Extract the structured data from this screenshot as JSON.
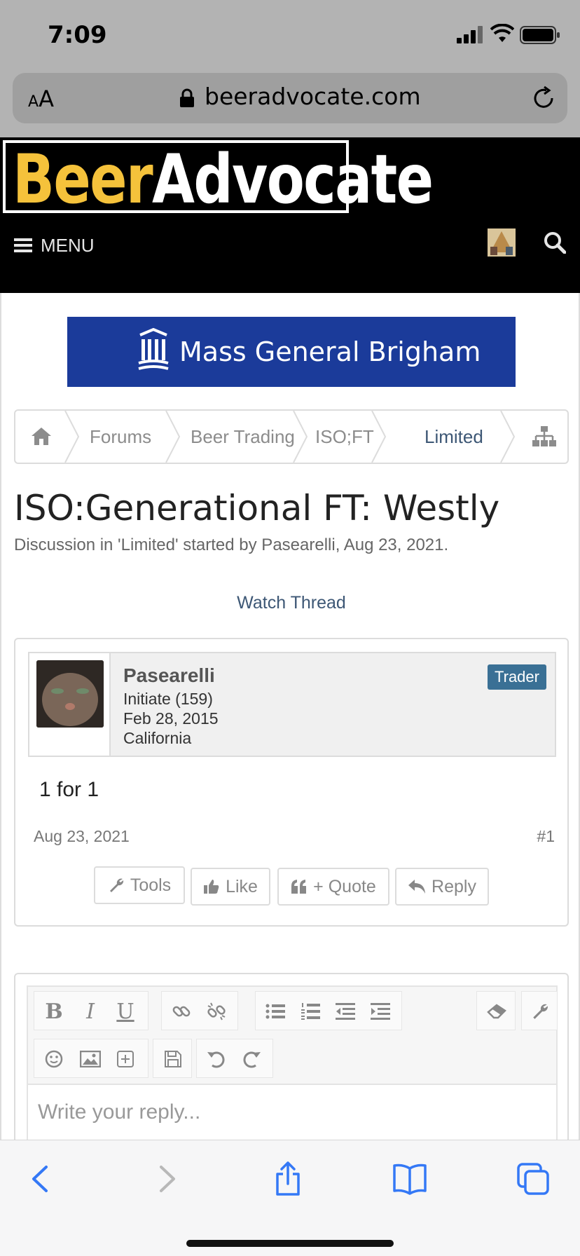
{
  "status": {
    "time": "7:09"
  },
  "browser": {
    "text_size": "AA",
    "url": "beeradvocate.com"
  },
  "site": {
    "logo_beer": "Beer",
    "logo_advocate": "Advocate",
    "menu_label": "MENU"
  },
  "ad": {
    "text": "Mass General Brigham"
  },
  "breadcrumbs": [
    "Forums",
    "Beer Trading",
    "ISO;FT",
    "Limited"
  ],
  "thread": {
    "title": "ISO:Generational FT: Westly",
    "subtitle": "Discussion in 'Limited' started by Pasearelli, Aug 23, 2021.",
    "watch_label": "Watch Thread"
  },
  "post": {
    "username": "Pasearelli",
    "rank": "Initiate (159)",
    "joined": "Feb 28, 2015",
    "location": "California",
    "badge": "Trader",
    "message": "1 for 1",
    "date": "Aug 23, 2021",
    "number": "#1",
    "buttons": {
      "tools": "Tools",
      "like": "Like",
      "quote": "+ Quote",
      "reply": "Reply"
    }
  },
  "editor": {
    "bold": "B",
    "italic": "I",
    "underline": "U",
    "placeholder": "Write your reply..."
  },
  "colors": {
    "header_bg": "#000000",
    "logo_yellow": "#f5c23b",
    "link_blue": "#3d5775",
    "badge_blue": "#3a7095",
    "ad_blue": "#1b3b9a",
    "ios_blue": "#3478f6"
  },
  "icons": [
    "home-icon",
    "sitemap-icon",
    "search-icon",
    "hamburger-icon",
    "wrench-icon",
    "thumbs-up-icon",
    "quote-icon",
    "reply-icon"
  ]
}
